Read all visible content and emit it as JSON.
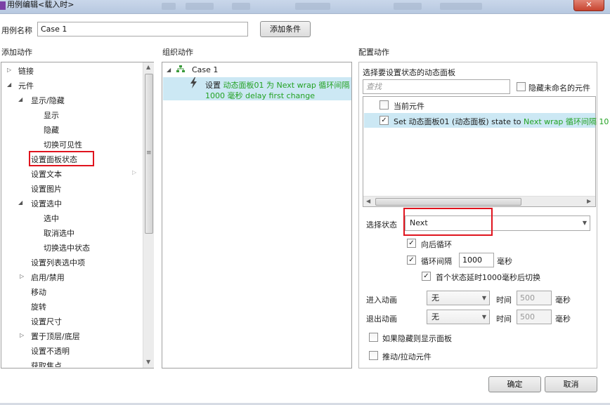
{
  "window": {
    "title": "用例编辑<载入时>",
    "close": "✕"
  },
  "case_name": {
    "label": "用例名称",
    "value": "Case 1",
    "add_condition": "添加条件"
  },
  "add_actions": {
    "title": "添加动作",
    "items": [
      "链接",
      "元件",
      "显示/隐藏",
      "显示",
      "隐藏",
      "切换可见性",
      "设置面板状态",
      "设置文本",
      "设置图片",
      "设置选中",
      "选中",
      "取消选中",
      "切换选中状态",
      "设置列表选中项",
      "启用/禁用",
      "移动",
      "旋转",
      "设置尺寸",
      "置于顶层/底层",
      "设置不透明",
      "获取焦点"
    ]
  },
  "organize_actions": {
    "title": "组织动作",
    "case": "Case 1",
    "action_prefix": "设置",
    "action_line1": "动态面板01 为 Next wrap 循环间隔",
    "action_line2": "1000 毫秒 delay first change"
  },
  "configure_actions": {
    "title": "配置动作",
    "subtitle": "选择要设置状态的动态面板",
    "search_placeholder": "查找",
    "hide_unnamed": "隐藏未命名的元件",
    "current_element": "当前元件",
    "set_prefix": "Set 动态面板01 (动态面板) state to",
    "set_suffix": "Next wrap 循环间隔 10",
    "select_state_label": "选择状态",
    "select_state_value": "Next",
    "wrap_label": "向后循环",
    "interval_label": "循环间隔",
    "interval_value": "1000",
    "interval_unit": "毫秒",
    "delay_first": "首个状态延时1000毫秒后切换",
    "enter_anim_label": "进入动画",
    "exit_anim_label": "退出动画",
    "anim_value": "无",
    "time_label": "时间",
    "time_value": "500",
    "time_unit": "毫秒",
    "show_if_hidden": "如果隐藏则显示面板",
    "push_pull": "推动/拉动元件"
  },
  "footer": {
    "ok": "确定",
    "cancel": "取消"
  },
  "colors": {
    "selected_row": "#cce8f4",
    "green_text": "#23a223",
    "highlight_box": "#e0141e"
  }
}
